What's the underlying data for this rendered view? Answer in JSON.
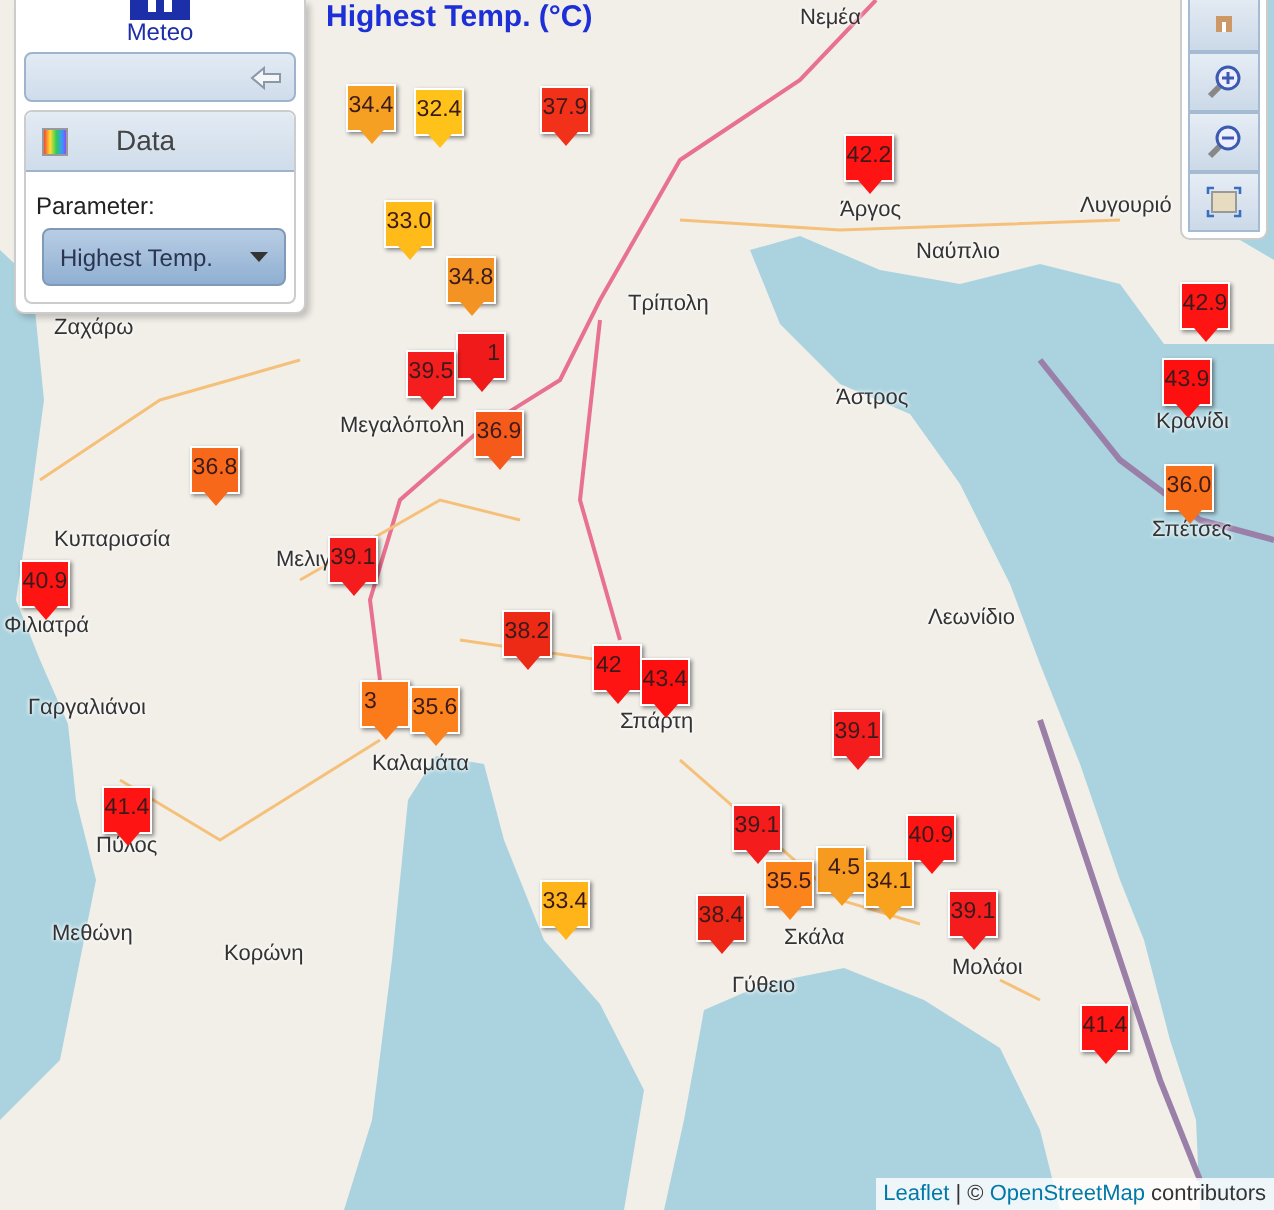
{
  "title": "Highest Temp. (°C)",
  "panel": {
    "logo_text": "Meteo",
    "data_button": "Data",
    "parameter_label": "Parameter:",
    "parameter_select": "Highest Temp."
  },
  "places": [
    {
      "name": "Νεμέα"
    },
    {
      "name": "Άργος"
    },
    {
      "name": "Λυγουριό"
    },
    {
      "name": "Ναύπλιο"
    },
    {
      "name": "Τρίπολη"
    },
    {
      "name": "Άστρος"
    },
    {
      "name": "Κρανίδι"
    },
    {
      "name": "Σπέτσες"
    },
    {
      "name": "Ζαχάρω"
    },
    {
      "name": "Μεγαλόπολη"
    },
    {
      "name": "Κυπαρισσία"
    },
    {
      "name": "Μελιγ"
    },
    {
      "name": "Φιλιατρά"
    },
    {
      "name": "Γαργαλιάνοι"
    },
    {
      "name": "Καλαμάτα"
    },
    {
      "name": "Σπάρτη"
    },
    {
      "name": "Λεωνίδιο"
    },
    {
      "name": "Πύλος"
    },
    {
      "name": "Μεθώνη"
    },
    {
      "name": "Κορώνη"
    },
    {
      "name": "Σκάλα"
    },
    {
      "name": "Μολάοι"
    },
    {
      "name": "Γύθειο"
    }
  ],
  "markers": [
    {
      "value": "34.4",
      "color": "#f5a023"
    },
    {
      "value": "32.4",
      "color": "#ffc21a"
    },
    {
      "value": "37.9",
      "color": "#f2311a"
    },
    {
      "value": "42.2",
      "color": "#ff1414"
    },
    {
      "value": "33.0",
      "color": "#ffbb1a"
    },
    {
      "value": "34.8",
      "color": "#f39323"
    },
    {
      "value": "42.9",
      "color": "#ff1414"
    },
    {
      "value": "39.5",
      "color": "#f41e1e"
    },
    {
      "value": "1",
      "color": "#f01a1a"
    },
    {
      "value": "43.9",
      "color": "#ff1010"
    },
    {
      "value": "36.8",
      "color": "#f8681a"
    },
    {
      "value": "36.9",
      "color": "#f65a1a"
    },
    {
      "value": "36.0",
      "color": "#f8701a"
    },
    {
      "value": "40.9",
      "color": "#ff1414"
    },
    {
      "value": "39.1",
      "color": "#f41c1c"
    },
    {
      "value": "38.2",
      "color": "#ec2a16"
    },
    {
      "value": "3",
      "color": "#fb7a1a"
    },
    {
      "value": "35.6",
      "color": "#fb821c"
    },
    {
      "value": "42",
      "color": "#ff1414"
    },
    {
      "value": "43.4",
      "color": "#ff1010"
    },
    {
      "value": "39.1",
      "color": "#f41c1c"
    },
    {
      "value": "41.4",
      "color": "#ff1414"
    },
    {
      "value": "39.1",
      "color": "#f41c1c"
    },
    {
      "value": "33.4",
      "color": "#ffb41a"
    },
    {
      "value": "38.4",
      "color": "#ee2616"
    },
    {
      "value": "35.5",
      "color": "#fb841c"
    },
    {
      "value": "4.5",
      "color": "#f79a20"
    },
    {
      "value": "34.1",
      "color": "#f9a21e"
    },
    {
      "value": "40.9",
      "color": "#ff1414"
    },
    {
      "value": "39.1",
      "color": "#f41c1c"
    },
    {
      "value": "41.4",
      "color": "#ff1414"
    }
  ],
  "attribution": {
    "link": "Leaflet",
    "separator": "| ©",
    "osm_link": "OpenStreetMap",
    "suffix": "contributors"
  }
}
